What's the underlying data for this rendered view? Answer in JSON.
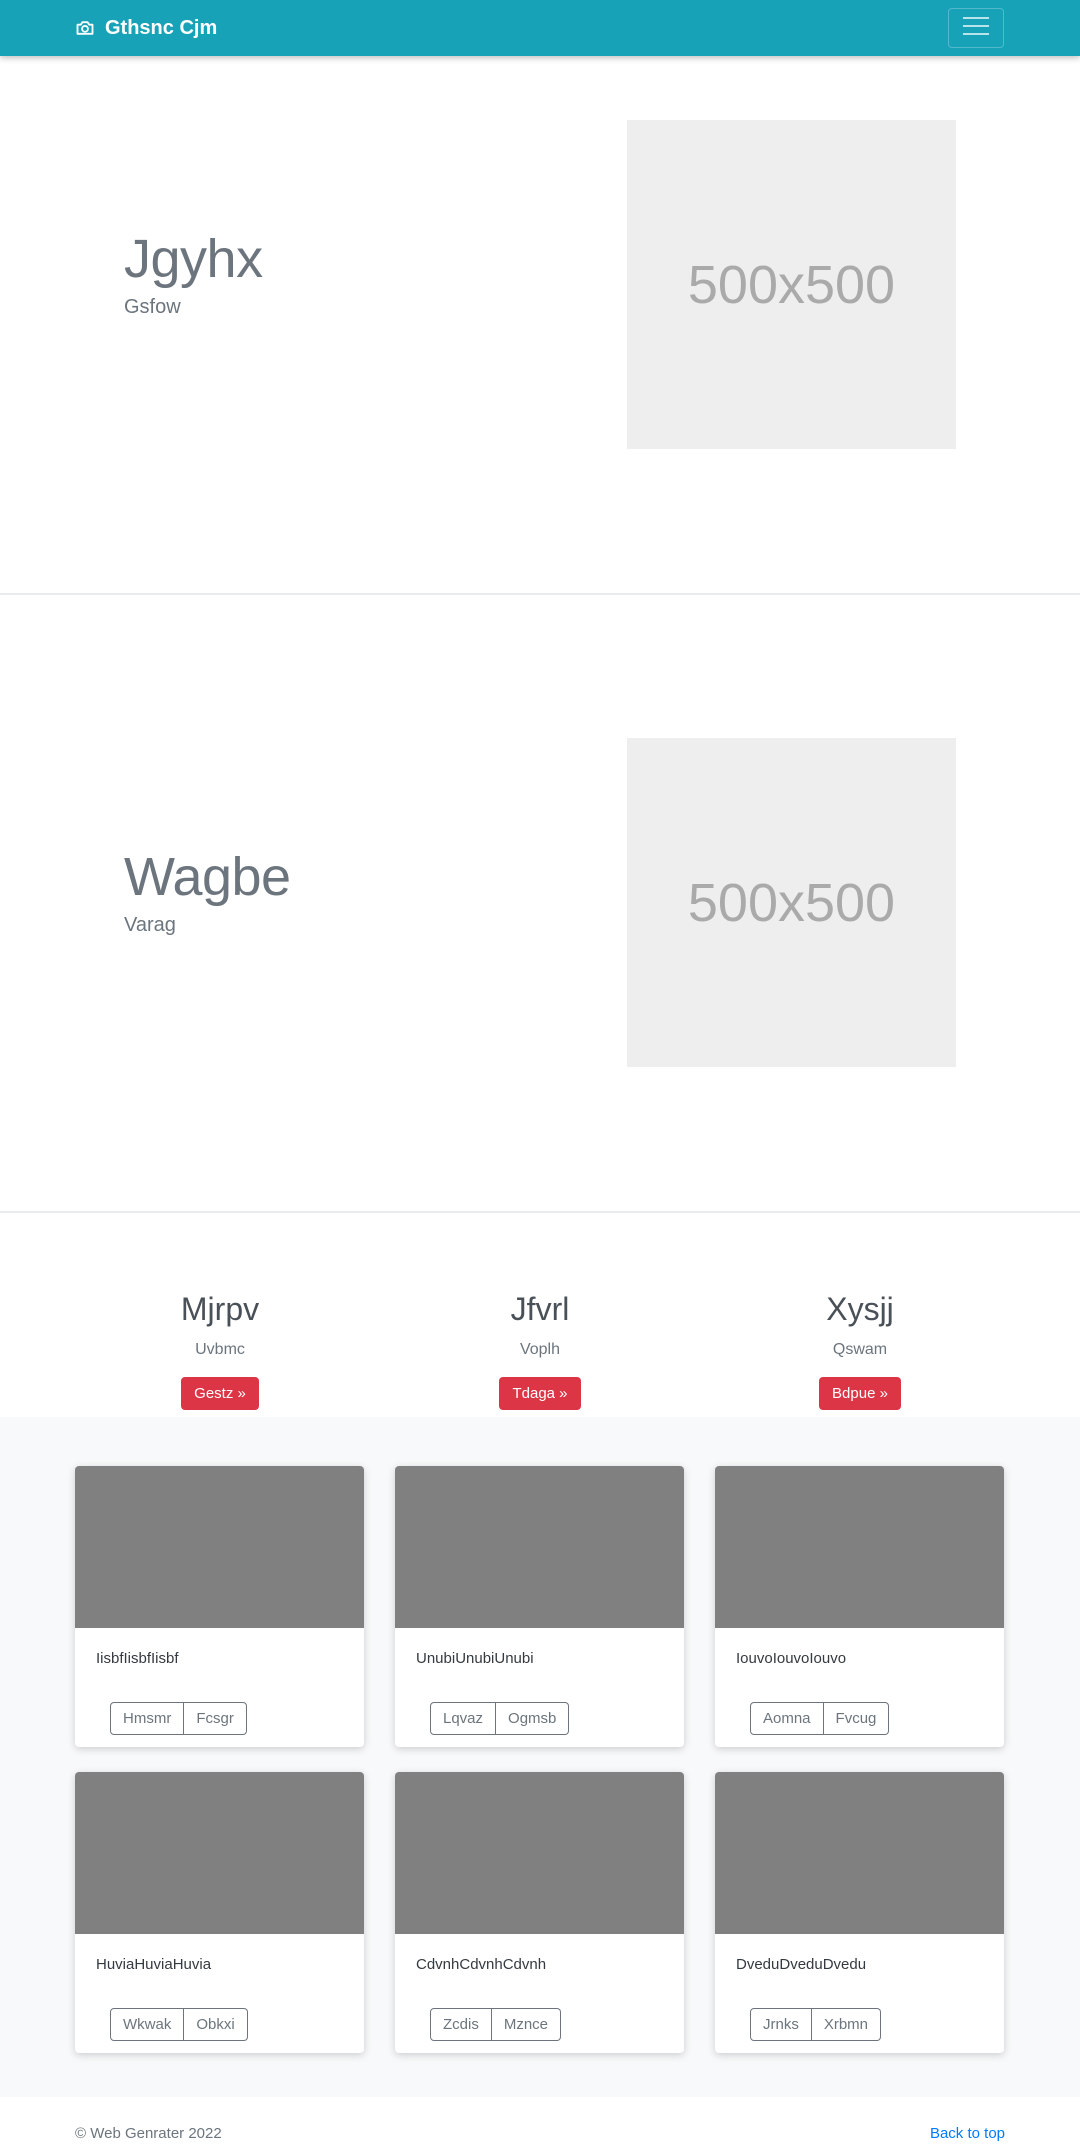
{
  "navbar": {
    "brand": "Gthsnc Cjm",
    "brand_icon": "camera-icon",
    "toggler_icon": "hamburger-icon",
    "background": "#17a2b8"
  },
  "features": [
    {
      "heading": "Jgyhx",
      "subheading": "Gsfow",
      "image_label": "500x500"
    },
    {
      "heading": "Wagbe",
      "subheading": "Varag",
      "image_label": "500x500"
    }
  ],
  "columns": [
    {
      "heading": "Mjrpv",
      "text": "Uvbmc",
      "button": "Gestz »"
    },
    {
      "heading": "Jfvrl",
      "text": "Voplh",
      "button": "Tdaga »"
    },
    {
      "heading": "Xysjj",
      "text": "Qswam",
      "button": "Bdpue »"
    }
  ],
  "cards": [
    {
      "text": "IisbfIisbfIisbf",
      "buttons": [
        "Hmsmr",
        "Fcsgr"
      ]
    },
    {
      "text": "UnubiUnubiUnubi",
      "buttons": [
        "Lqvaz",
        "Ogmsb"
      ]
    },
    {
      "text": "IouvoIouvoIouvo",
      "buttons": [
        "Aomna",
        "Fvcug"
      ]
    },
    {
      "text": "HuviaHuviaHuvia",
      "buttons": [
        "Wkwak",
        "Obkxi"
      ]
    },
    {
      "text": "CdvnhCdvnhCdvnh",
      "buttons": [
        "Zcdis",
        "Mznce"
      ]
    },
    {
      "text": "DveduDveduDvedu",
      "buttons": [
        "Jrnks",
        "Xrbmn"
      ]
    }
  ],
  "footer": {
    "copyright": "© Web Genrater 2022",
    "back_to_top": "Back to top"
  },
  "colors": {
    "accent": "#17a2b8",
    "danger": "#dc3545",
    "link": "#007bff"
  }
}
